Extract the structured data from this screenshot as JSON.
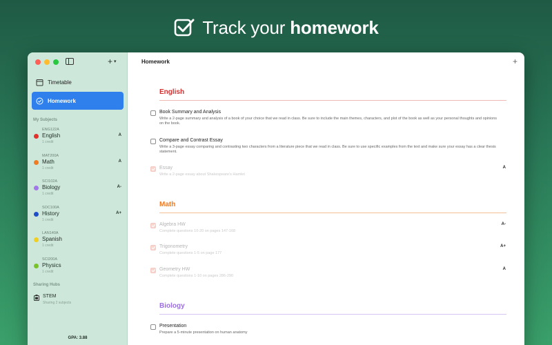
{
  "hero": {
    "prefix": "Track your ",
    "bold": "homework"
  },
  "sidebar": {
    "nav": [
      {
        "label": "Timetable"
      },
      {
        "label": "Homework"
      }
    ],
    "subjects_heading": "My Subjects",
    "subjects": [
      {
        "code": "ENG122A",
        "name": "English",
        "credit": "1 credit",
        "grade": "A",
        "color": "#e0312c"
      },
      {
        "code": "MAT200A",
        "name": "Math",
        "credit": "1 credit",
        "grade": "A",
        "color": "#ef7b22"
      },
      {
        "code": "SCI102A",
        "name": "Biology",
        "credit": "1 credit",
        "grade": "A-",
        "color": "#a178e8"
      },
      {
        "code": "SOC100A",
        "name": "History",
        "credit": "1 credit",
        "grade": "A+",
        "color": "#1f4ec9"
      },
      {
        "code": "LAN140A",
        "name": "Spanish",
        "credit": "1 credit",
        "grade": "",
        "color": "#f1cf22"
      },
      {
        "code": "SCI200A",
        "name": "Physics",
        "credit": "1 credit",
        "grade": "",
        "color": "#79c229"
      }
    ],
    "hubs_heading": "Sharing Hubs",
    "hub": {
      "name": "STEM",
      "sub": "Sharing 2 subjects"
    },
    "gpa": "GPA: 3.88"
  },
  "main": {
    "title": "Homework",
    "groups": [
      {
        "name": "English",
        "color": "#d32f2f",
        "rule_color": "#f0b9b3",
        "tasks": [
          {
            "title": "Book Summary and Analysis",
            "desc": "Write a 2-page summary and analysis of a book of your choice that we read in class. Be sure to include the main themes, characters, and plot of the book as well as your personal thoughts and opinions on the book.",
            "grade": "",
            "done": false
          },
          {
            "title": "Compare and Contrast Essay",
            "desc": "Write a 3-page essay comparing and contrasting two characters from a literature piece that we read in class. Be sure to use specific examples from the text and make sure your essay has a clear thesis statement.",
            "grade": "",
            "done": false
          },
          {
            "title": "Essay",
            "desc": "Write a 2-page essay about Shakespeare's Hamlet",
            "grade": "A",
            "done": true
          }
        ]
      },
      {
        "name": "Math",
        "color": "#ef7b22",
        "rule_color": "#f4bf94",
        "tasks": [
          {
            "title": "Algebra HW",
            "desc": "Complete questions 10-20 on pages 147-168",
            "grade": "A-",
            "done": true
          },
          {
            "title": "Trigonometry",
            "desc": "Complete questions 1-5 on page 177",
            "grade": "A+",
            "done": true
          },
          {
            "title": "Geometry HW",
            "desc": "Complete questions 1-10 on pages 286-290",
            "grade": "A",
            "done": true
          }
        ]
      },
      {
        "name": "Biology",
        "color": "#9b6fe0",
        "rule_color": "#d7c6f3",
        "tasks": [
          {
            "title": "Presentation",
            "desc": "Prepare a 5-minute presentation on human anatomy",
            "grade": "",
            "done": false
          }
        ]
      }
    ]
  }
}
